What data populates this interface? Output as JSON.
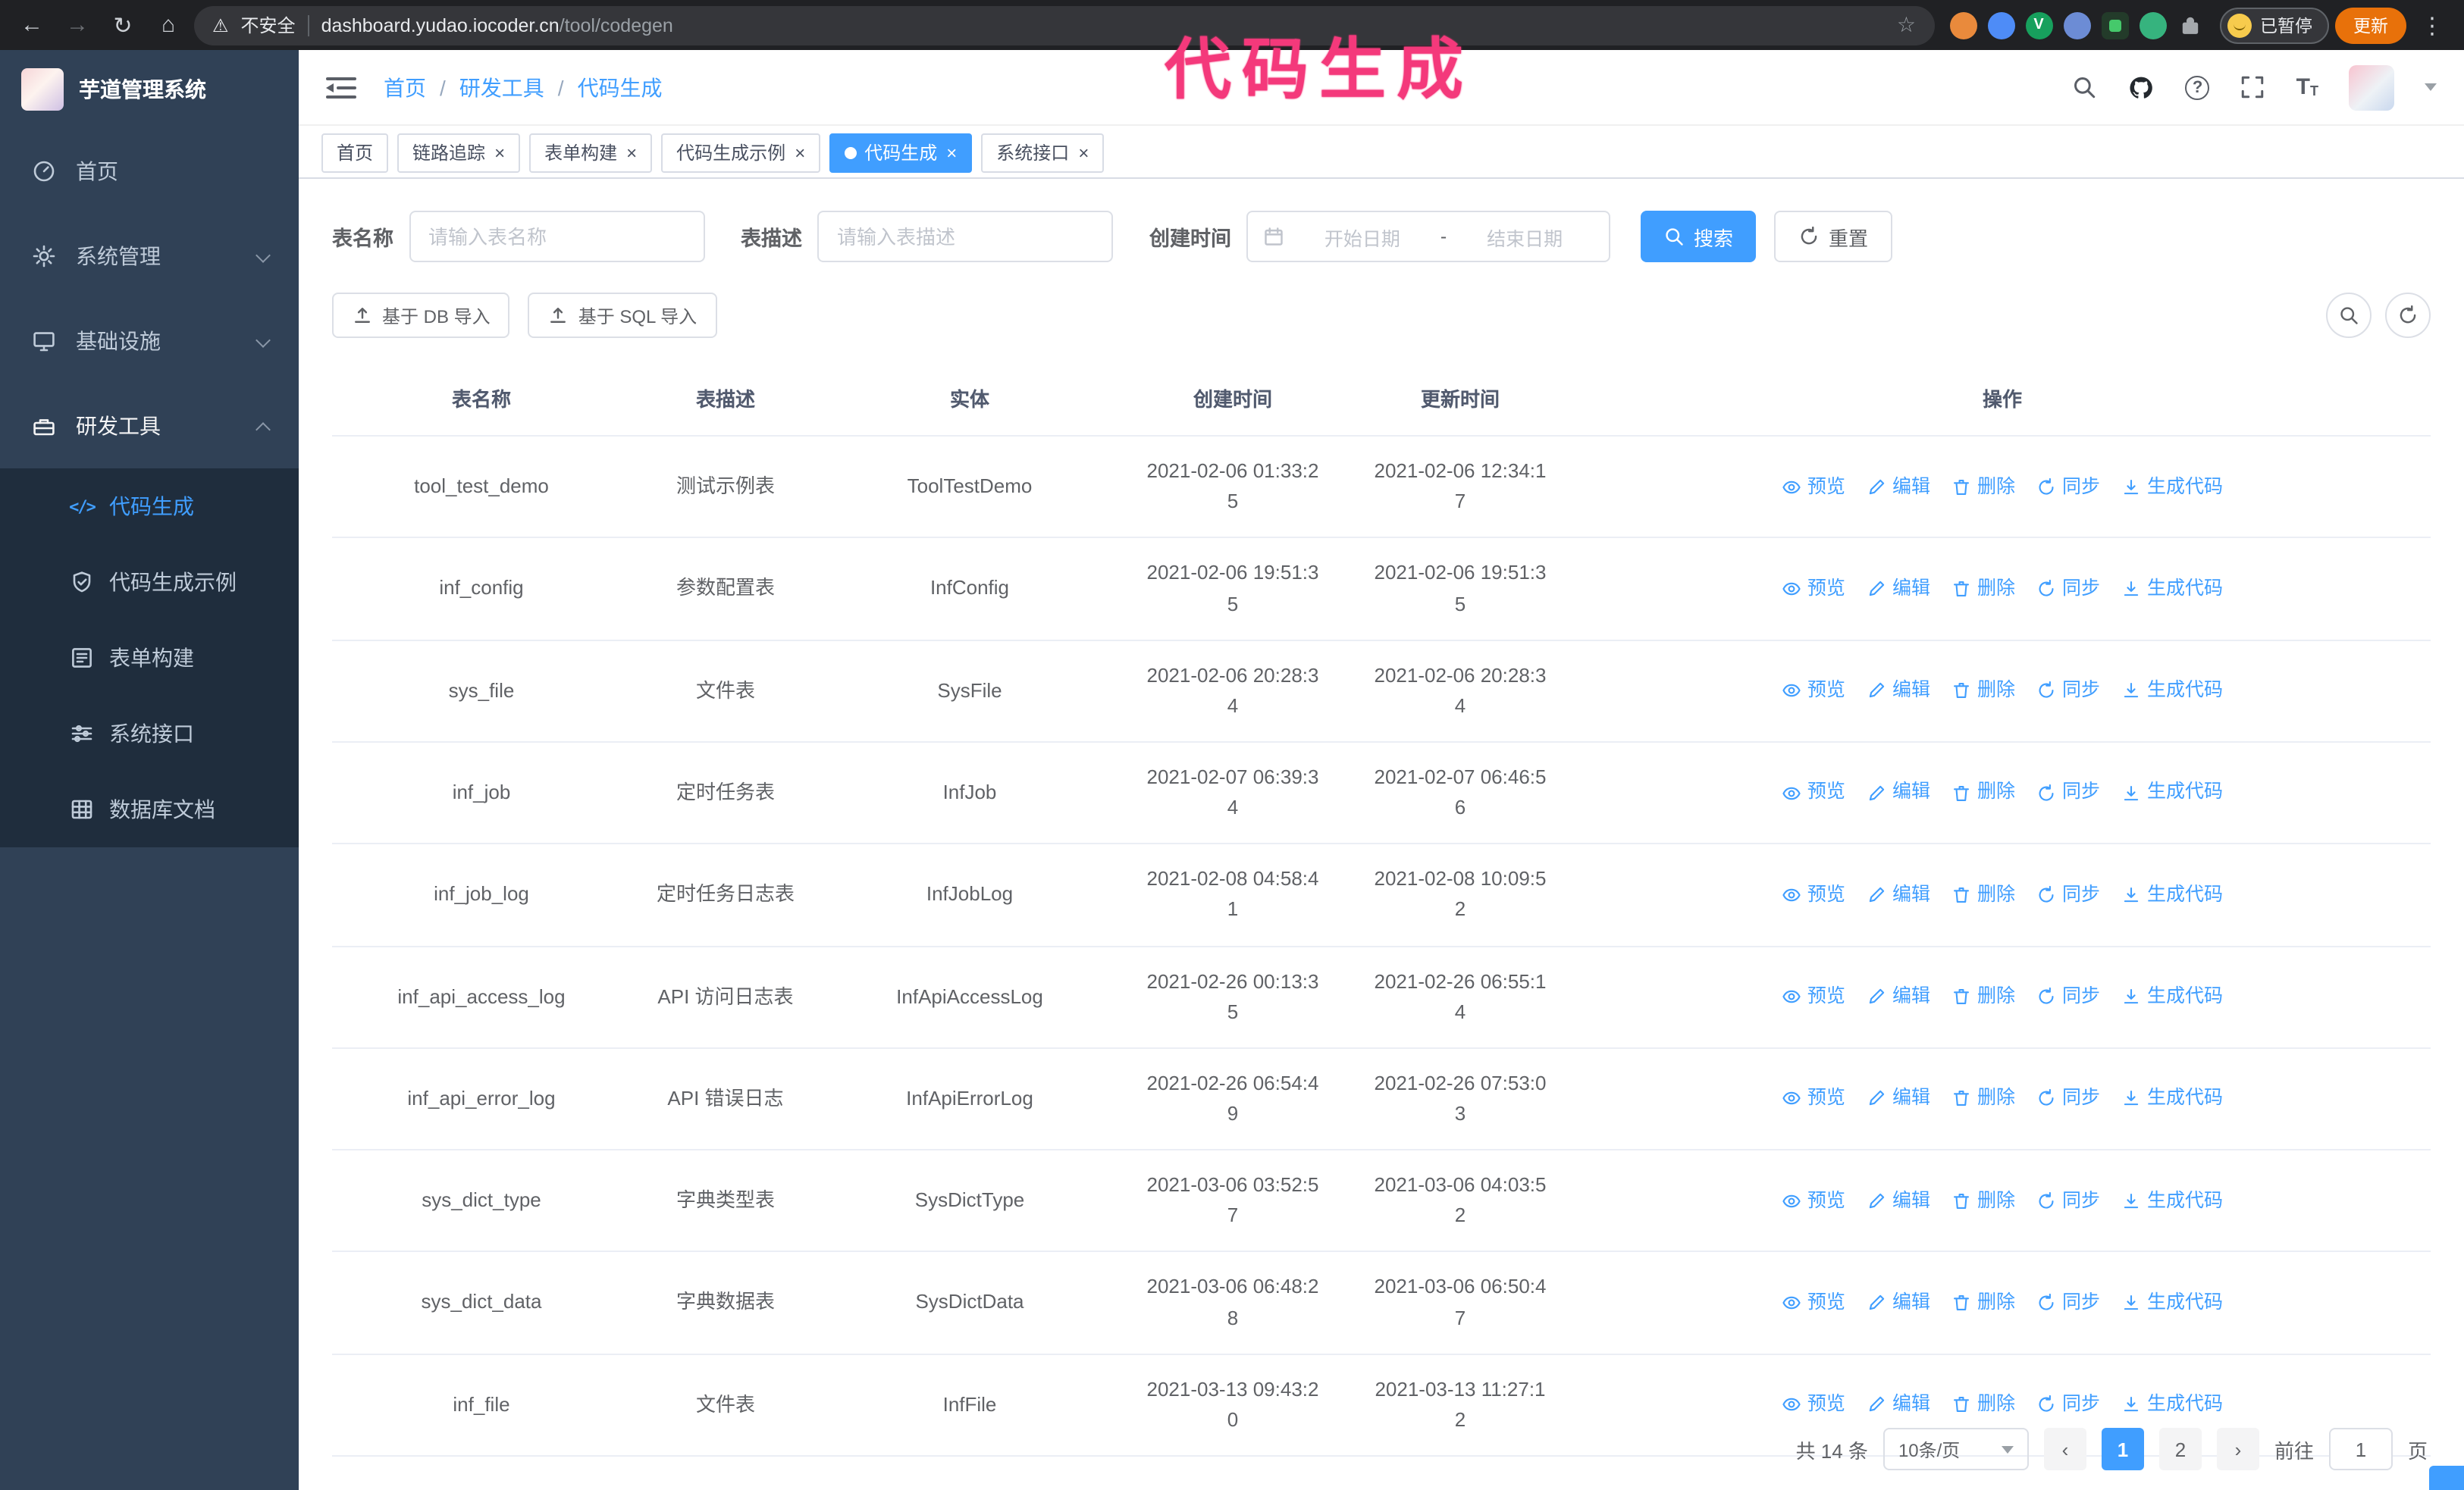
{
  "colors": {
    "accent": "#409eff",
    "annotation": "#f4397b",
    "sidebar_bg": "#304156",
    "submenu_bg": "#1f2d3d"
  },
  "browser": {
    "security_label": "不安全",
    "url_host": "dashboard.yudao.iocoder.cn",
    "url_path": "/tool/codegen",
    "profile_badge": "已暂停",
    "update_label": "更新"
  },
  "annotation": {
    "text": "代码生成"
  },
  "sidebar": {
    "title": "芋道管理系统",
    "items": [
      {
        "label": "首页"
      },
      {
        "label": "系统管理"
      },
      {
        "label": "基础设施"
      },
      {
        "label": "研发工具"
      }
    ],
    "submenu": [
      {
        "label": "代码生成",
        "active": true
      },
      {
        "label": "代码生成示例",
        "active": false
      },
      {
        "label": "表单构建",
        "active": false
      },
      {
        "label": "系统接口",
        "active": false
      },
      {
        "label": "数据库文档",
        "active": false
      }
    ]
  },
  "header": {
    "breadcrumb": [
      "首页",
      "研发工具",
      "代码生成"
    ]
  },
  "tabs": [
    {
      "label": "首页",
      "closable": false,
      "active": false
    },
    {
      "label": "链路追踪",
      "closable": true,
      "active": false
    },
    {
      "label": "表单构建",
      "closable": true,
      "active": false
    },
    {
      "label": "代码生成示例",
      "closable": true,
      "active": false
    },
    {
      "label": "代码生成",
      "closable": true,
      "active": true
    },
    {
      "label": "系统接口",
      "closable": true,
      "active": false
    }
  ],
  "filters": {
    "table_name_label": "表名称",
    "table_name_placeholder": "请输入表名称",
    "table_desc_label": "表描述",
    "table_desc_placeholder": "请输入表描述",
    "create_time_label": "创建时间",
    "date_start_placeholder": "开始日期",
    "date_separator": "-",
    "date_end_placeholder": "结束日期",
    "search_label": "搜索",
    "reset_label": "重置"
  },
  "toolbar": {
    "import_db_label": "基于 DB 导入",
    "import_sql_label": "基于 SQL 导入"
  },
  "table": {
    "columns": [
      "表名称",
      "表描述",
      "实体",
      "创建时间",
      "更新时间",
      "操作"
    ],
    "actions": [
      "预览",
      "编辑",
      "删除",
      "同步",
      "生成代码"
    ],
    "rows": [
      {
        "name": "tool_test_demo",
        "desc": "测试示例表",
        "entity": "ToolTestDemo",
        "created": "2021-02-06 01:33:25",
        "updated": "2021-02-06 12:34:17"
      },
      {
        "name": "inf_config",
        "desc": "参数配置表",
        "entity": "InfConfig",
        "created": "2021-02-06 19:51:35",
        "updated": "2021-02-06 19:51:35"
      },
      {
        "name": "sys_file",
        "desc": "文件表",
        "entity": "SysFile",
        "created": "2021-02-06 20:28:34",
        "updated": "2021-02-06 20:28:34"
      },
      {
        "name": "inf_job",
        "desc": "定时任务表",
        "entity": "InfJob",
        "created": "2021-02-07 06:39:34",
        "updated": "2021-02-07 06:46:56"
      },
      {
        "name": "inf_job_log",
        "desc": "定时任务日志表",
        "entity": "InfJobLog",
        "created": "2021-02-08 04:58:41",
        "updated": "2021-02-08 10:09:52"
      },
      {
        "name": "inf_api_access_log",
        "desc": "API 访问日志表",
        "entity": "InfApiAccessLog",
        "created": "2021-02-26 00:13:35",
        "updated": "2021-02-26 06:55:14"
      },
      {
        "name": "inf_api_error_log",
        "desc": "API 错误日志",
        "entity": "InfApiErrorLog",
        "created": "2021-02-26 06:54:49",
        "updated": "2021-02-26 07:53:03"
      },
      {
        "name": "sys_dict_type",
        "desc": "字典类型表",
        "entity": "SysDictType",
        "created": "2021-03-06 03:52:57",
        "updated": "2021-03-06 04:03:52"
      },
      {
        "name": "sys_dict_data",
        "desc": "字典数据表",
        "entity": "SysDictData",
        "created": "2021-03-06 06:48:28",
        "updated": "2021-03-06 06:50:47"
      },
      {
        "name": "inf_file",
        "desc": "文件表",
        "entity": "InfFile",
        "created": "2021-03-13 09:43:20",
        "updated": "2021-03-13 11:27:12"
      }
    ]
  },
  "pagination": {
    "total": "共 14 条",
    "page_size": "10条/页",
    "pages": [
      "1",
      "2"
    ],
    "active_page": "1",
    "goto_label": "前往",
    "goto_value": "1",
    "goto_unit": "页"
  }
}
